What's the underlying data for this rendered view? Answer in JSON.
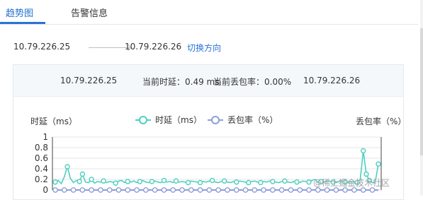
{
  "tabs": [
    {
      "label": "趋势图",
      "active": true
    },
    {
      "label": "告警信息",
      "active": false
    }
  ],
  "direction": {
    "source_ip": "10.79.226.25",
    "dest_ip": "10.79.226.26",
    "switch_label": "切换方向"
  },
  "status": {
    "source_ip": "10.79.226.25",
    "latency_text": "当前时延：0.49 ms",
    "loss_text": "当前丢包率：0.00%",
    "dest_ip": "10.79.226.26"
  },
  "chart_data": {
    "type": "line",
    "ylabel_left": "时延（ms）",
    "ylabel_right": "丢包率（%）",
    "ylim": [
      0,
      1
    ],
    "yticks": [
      "1",
      "0.8",
      "0.6",
      "0.4",
      "0.2",
      "0"
    ],
    "legend_position": "top-center",
    "series": [
      {
        "name": "时延（ms）",
        "color": "#4fcfc0",
        "values": [
          0.15,
          0.18,
          0.12,
          0.25,
          0.44,
          0.22,
          0.14,
          0.18,
          0.16,
          0.3,
          0.15,
          0.14,
          0.2,
          0.13,
          0.16,
          0.15,
          0.17,
          0.14,
          0.16,
          0.15,
          0.13,
          0.17,
          0.18,
          0.14,
          0.16,
          0.15,
          0.17,
          0.14,
          0.16,
          0.18,
          0.15,
          0.14,
          0.16,
          0.17,
          0.15,
          0.14,
          0.18,
          0.15,
          0.16,
          0.14,
          0.17,
          0.15,
          0.16,
          0.15,
          0.14,
          0.17,
          0.16,
          0.15,
          0.14,
          0.16,
          0.15,
          0.17,
          0.18,
          0.15,
          0.14,
          0.16,
          0.17,
          0.15,
          0.14,
          0.16,
          0.15,
          0.17,
          0.16,
          0.15,
          0.14,
          0.16,
          0.17,
          0.15,
          0.14,
          0.16,
          0.15,
          0.17,
          0.16,
          0.15,
          0.14,
          0.16,
          0.17,
          0.15,
          0.14,
          0.16,
          0.15,
          0.14,
          0.17,
          0.16,
          0.15,
          0.18,
          0.2,
          0.14,
          0.16,
          0.15,
          0.17,
          0.16,
          0.15,
          0.14,
          0.16,
          0.17,
          0.15,
          0.14,
          0.16,
          0.15,
          0.14,
          0.2,
          0.74,
          0.3,
          0.18,
          0.14,
          0.16,
          0.49
        ]
      },
      {
        "name": "丢包率（%）",
        "color": "#8e9ed8",
        "values": [
          0,
          0,
          0,
          0,
          0,
          0,
          0,
          0,
          0,
          0,
          0,
          0,
          0,
          0,
          0,
          0,
          0,
          0,
          0,
          0,
          0,
          0,
          0,
          0,
          0,
          0,
          0,
          0,
          0,
          0,
          0,
          0,
          0,
          0,
          0,
          0,
          0,
          0,
          0,
          0,
          0,
          0,
          0,
          0,
          0,
          0,
          0,
          0,
          0,
          0,
          0,
          0,
          0,
          0,
          0,
          0,
          0,
          0,
          0,
          0,
          0,
          0,
          0,
          0,
          0,
          0,
          0,
          0,
          0,
          0,
          0,
          0,
          0,
          0,
          0,
          0,
          0,
          0,
          0,
          0,
          0,
          0,
          0,
          0,
          0,
          0,
          0,
          0,
          0,
          0,
          0,
          0,
          0,
          0,
          0,
          0,
          0,
          0,
          0,
          0,
          0,
          0,
          0,
          0,
          0,
          0,
          0,
          0
        ]
      }
    ]
  },
  "watermark": "@稀土掘金技术社区"
}
